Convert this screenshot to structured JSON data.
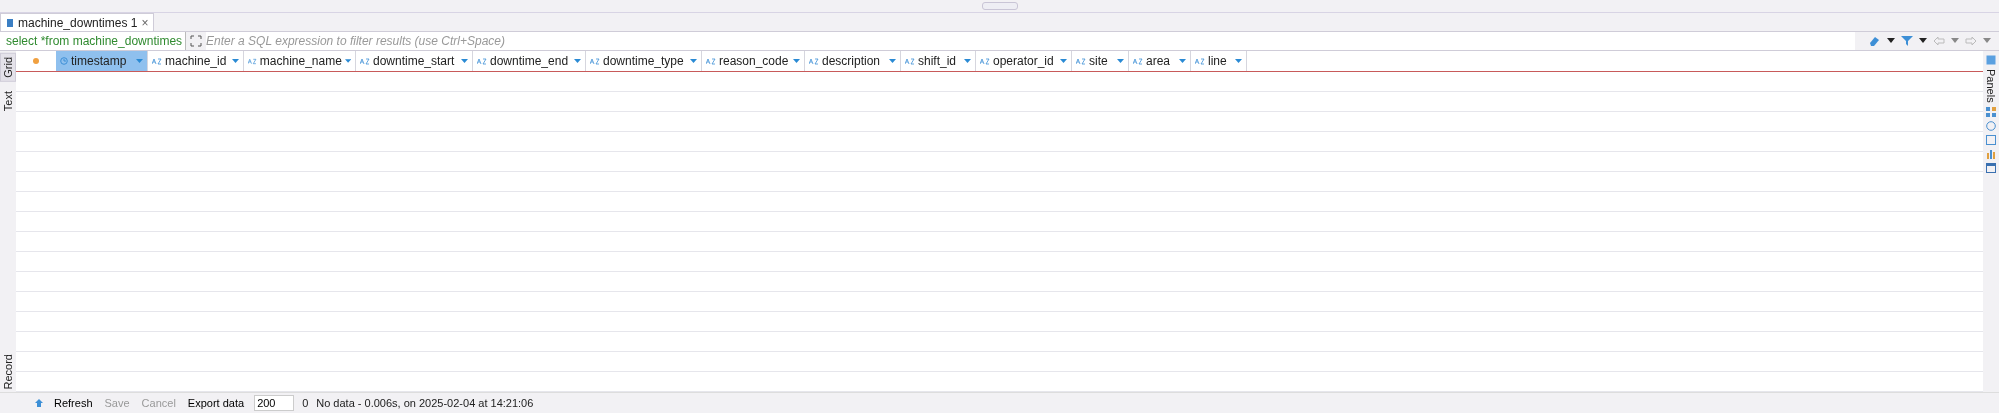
{
  "editor_tabs": [
    {
      "label": "machine_downtimes 1",
      "close": "×",
      "selected": true
    }
  ],
  "filter": {
    "query": "select *from machine_downtimes",
    "placeholder": "Enter a SQL expression to filter results (use Ctrl+Space)"
  },
  "view_tabs": [
    {
      "label": "Grid",
      "selected": true
    },
    {
      "label": "Text",
      "selected": false
    }
  ],
  "record_tab": {
    "label": "Record"
  },
  "side_panel": {
    "label": "Panels"
  },
  "table": {
    "columns": [
      {
        "name": "timestamp",
        "kind": "datetime",
        "selected": true
      },
      {
        "name": "machine_id",
        "kind": "string",
        "selected": false
      },
      {
        "name": "machine_name",
        "kind": "string",
        "selected": false
      },
      {
        "name": "downtime_start",
        "kind": "string",
        "selected": false
      },
      {
        "name": "downtime_end",
        "kind": "string",
        "selected": false
      },
      {
        "name": "downtime_type",
        "kind": "string",
        "selected": false
      },
      {
        "name": "reason_code",
        "kind": "string",
        "selected": false
      },
      {
        "name": "description",
        "kind": "string",
        "selected": false
      },
      {
        "name": "shift_id",
        "kind": "string",
        "selected": false
      },
      {
        "name": "operator_id",
        "kind": "string",
        "selected": false
      },
      {
        "name": "site",
        "kind": "string",
        "selected": false
      },
      {
        "name": "area",
        "kind": "string",
        "selected": false
      },
      {
        "name": "line",
        "kind": "string",
        "selected": false
      }
    ]
  },
  "status_bar": {
    "refresh": "Refresh",
    "save": "Save",
    "cancel": "Cancel",
    "export": "Export data",
    "fetch_size": "200",
    "row_count": "0",
    "message": "No data - 0.006s, on 2025-02-04 at 14:21:06"
  }
}
